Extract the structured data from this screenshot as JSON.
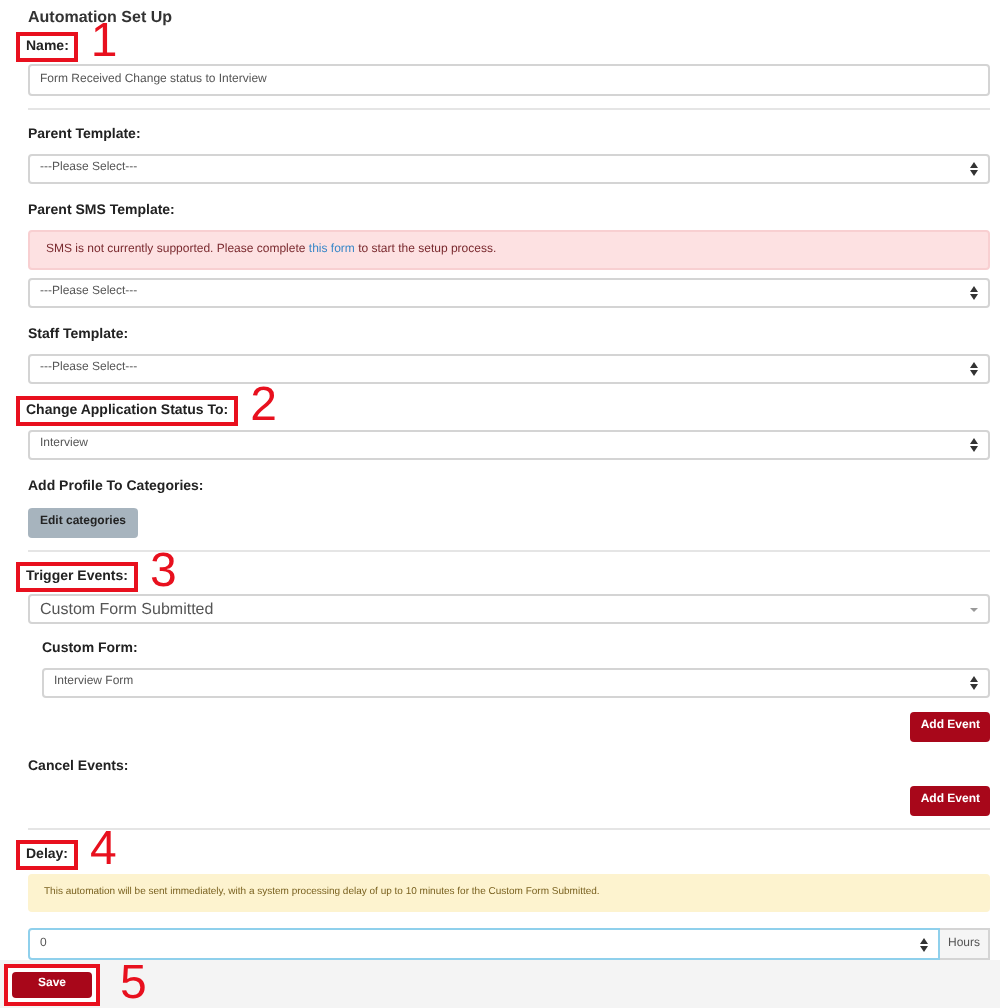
{
  "title": "Automation Set Up",
  "items": [
    {
      "kind": "input",
      "label": "Name:",
      "callout": "1",
      "value": "Form Received Change status to Interview"
    },
    {
      "kind": "divider"
    },
    {
      "kind": "select",
      "label": "Parent Template:",
      "value": "---Please Select---"
    },
    {
      "kind": "select",
      "label": "Parent SMS Template:",
      "alert": {
        "before": "SMS is not currently supported. Please complete ",
        "link": "this form",
        "after": " to start the setup process."
      },
      "value": "---Please Select---"
    },
    {
      "kind": "select",
      "label": "Staff Template:",
      "value": "---Please Select---"
    },
    {
      "kind": "select",
      "label": "Change Application Status To:",
      "callout": "2",
      "value": "Interview"
    },
    {
      "kind": "categories",
      "label": "Add Profile To Categories:",
      "button": "Edit categories"
    },
    {
      "kind": "divider"
    },
    {
      "kind": "trigger",
      "label": "Trigger Events:",
      "callout": "3",
      "value": "Custom Form Submitted",
      "sub_label": "Custom Form:",
      "sub_value": "Interview Form",
      "button": "Add Event"
    },
    {
      "kind": "cancel",
      "label": "Cancel Events:",
      "button": "Add Event"
    },
    {
      "kind": "divider"
    },
    {
      "kind": "delay",
      "label": "Delay:",
      "callout": "4",
      "notice": "This automation will be sent immediately, with a system processing delay of up to 10 minutes for the Custom Form Submitted.",
      "value": "0",
      "unit": "Hours"
    }
  ],
  "footer": {
    "button": "Save",
    "callout": "5"
  }
}
